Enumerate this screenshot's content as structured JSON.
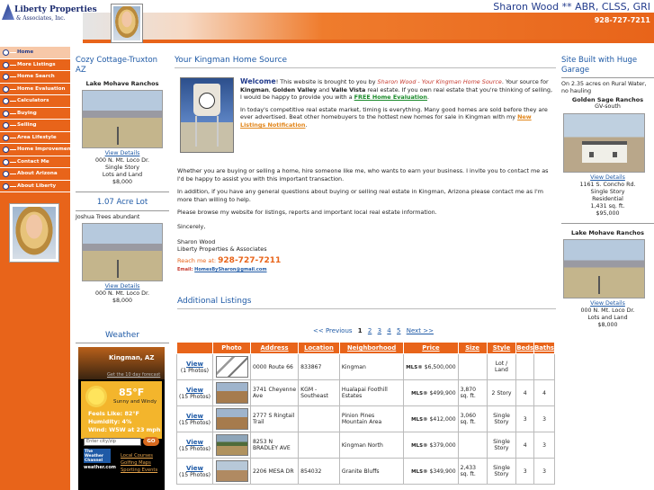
{
  "header": {
    "logo_line1": "Liberty Properties",
    "logo_line2": "& Associates, Inc.",
    "agent": "Sharon Wood ** ABR, CLSS, GRI",
    "phone": "928-727-7211"
  },
  "nav": [
    {
      "label": "Home",
      "active": true
    },
    {
      "label": "More Listings"
    },
    {
      "label": "Home Search"
    },
    {
      "label": "Home Evaluation"
    },
    {
      "label": "Calculators"
    },
    {
      "label": "Buying"
    },
    {
      "label": "Selling"
    },
    {
      "label": "Area Lifestyle"
    },
    {
      "label": "Home Improvement"
    },
    {
      "label": "Contact Me"
    },
    {
      "label": "About Arizona"
    },
    {
      "label": "About Liberty"
    }
  ],
  "left": {
    "feature1": {
      "title": "Cozy Cottage-Truxton AZ",
      "sub": "Lake Mohave Ranchos",
      "link": "View Details",
      "lines": [
        "000 N. Mt. Loco Dr.",
        "Single Story",
        "Lots and Land",
        "$8,000"
      ]
    },
    "feature2": {
      "title": "1.07 Acre Lot",
      "sub": "Joshua Trees abundant",
      "link": "View Details",
      "lines": [
        "000 N. Mt. Loco Dr.",
        "$8,000"
      ]
    },
    "weather": {
      "title": "Weather",
      "city": "Kingman, AZ",
      "forecast_link": "Get the 10 day forecast",
      "temp": "85°F",
      "cond": "Sunny and Windy",
      "feels": "Feels Like: 82°F",
      "humidity": "Humidity: 4%",
      "wind": "Wind: W5W at 23 mph",
      "zip_placeholder": "Enter city/zip",
      "go": "GO",
      "brand": "The Weather Channel",
      "url": "weather.com",
      "links": [
        "Local Courses",
        "Golfing Maps",
        "Sporting Events"
      ]
    }
  },
  "main": {
    "title": "Your Kingman Home Source",
    "welcome": "Welcome",
    "intro_a": "! This website is brought to you by ",
    "intro_agent": "Sharon Wood - Your Kingman Home Source",
    "intro_b": ". Your source for ",
    "intro_places": [
      "Kingman",
      "Golden Valley",
      "Valle Vista"
    ],
    "intro_c": " real estate. If you own real estate that you're thinking of selling, I would be happy to provide you with a ",
    "eval_link": "FREE Home Evaluation",
    "p2": "In today's competitive real estate market, timing is everything. Many good homes are sold before they are ever advertised. Beat other homebuyers to the hottest new homes for sale in Kingman with my ",
    "notify_link": "New Listings Notification",
    "p3": "Whether you are buying or selling a home, hire someone like me, who wants to earn your business. I invite you to contact me as I'd be happy to assist you with this important transaction.",
    "p4": "In addition, if you have any general questions about buying or selling real estate in Kingman, Arizona please contact me as I'm more than willing to help.",
    "p5": "Please browse my website for listings, reports and important local real estate information.",
    "sincerely": "Sincerely,",
    "sig1": "Sharon Wood",
    "sig2": "Liberty Properties & Associates",
    "reach": "Reach me at: ",
    "reach_phone": "928-727-7211",
    "email_label": "Email: ",
    "email": "HomesBySharon@gmail.com"
  },
  "additional": {
    "title": "Additional Listings",
    "pager": {
      "prev": "<< Previous",
      "pages": [
        "1",
        "2",
        "3",
        "4",
        "5"
      ],
      "current": "1",
      "next": "Next >>"
    },
    "columns": [
      "Photo",
      "Address",
      "Location",
      "Neighborhood",
      "Price",
      "Size",
      "Style",
      "Beds",
      "Baths"
    ],
    "rows": [
      {
        "view": "View",
        "photos": "(1 Photos)",
        "address": "0000 Route 66",
        "location": "833867",
        "neighborhood": "Kingman",
        "mls": "MLS®",
        "price": "$6,500,000",
        "size": "",
        "style": "Lot / Land",
        "beds": "",
        "baths": ""
      },
      {
        "view": "View",
        "photos": "(15 Photos)",
        "address": "3741 Cheyenne Ave",
        "location": "KGM - Southeast",
        "neighborhood": "Hualapai Foothill Estates",
        "mls": "MLS®",
        "price": "$499,900",
        "size": "3,870 sq. ft.",
        "style": "2 Story",
        "beds": "4",
        "baths": "4"
      },
      {
        "view": "View",
        "photos": "(15 Photos)",
        "address": "2777 S Ringtail Trail",
        "location": "",
        "neighborhood": "Pinion Pines Mountain Area",
        "mls": "MLS®",
        "price": "$412,000",
        "size": "3,060 sq. ft.",
        "style": "Single Story",
        "beds": "3",
        "baths": "3"
      },
      {
        "view": "View",
        "photos": "(15 Photos)",
        "address": "8253 N BRADLEY AVE",
        "location": "",
        "neighborhood": "Kingman North",
        "mls": "MLS®",
        "price": "$379,000",
        "size": "",
        "style": "Single Story",
        "beds": "4",
        "baths": "3"
      },
      {
        "view": "View",
        "photos": "(15 Photos)",
        "address": "2206 MESA DR",
        "location": "854032",
        "neighborhood": "Granite Bluffs",
        "mls": "MLS®",
        "price": "$349,900",
        "size": "2,433 sq. ft.",
        "style": "Single Story",
        "beds": "3",
        "baths": "3"
      }
    ]
  },
  "right": {
    "feature1": {
      "title": "Site Built with Huge Garage",
      "desc": "On 2.35 acres on Rural Water, no hauling",
      "sub": "Golden Sage Ranchos",
      "sub2": "GV-south",
      "link": "View Details",
      "lines": [
        "1161 S. Concho Rd.",
        "Single Story",
        "Residential",
        "1,431 sq. ft.",
        "$95,000"
      ]
    },
    "feature2": {
      "sub": "Lake Mohave Ranchos",
      "link": "View Details",
      "lines": [
        "000 N. Mt. Loco Dr.",
        "Lots and Land",
        "$8,000"
      ]
    }
  }
}
